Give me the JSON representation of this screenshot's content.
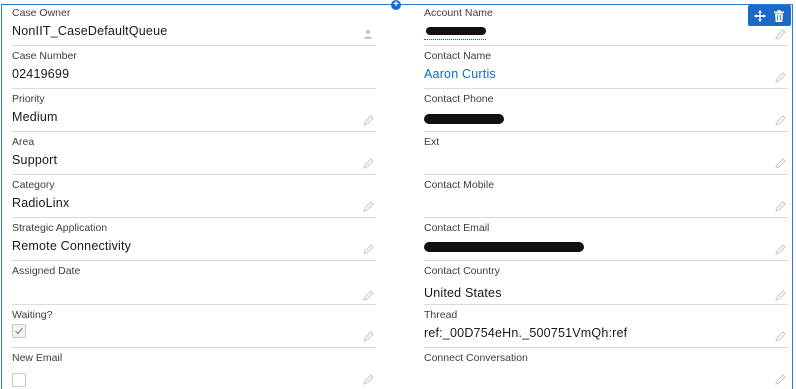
{
  "left_fields": [
    {
      "label": "Case Owner",
      "value": "NonIIT_CaseDefaultQueue",
      "type": "text",
      "icon": "user-change-icon"
    },
    {
      "label": "Case Number",
      "value": "02419699",
      "type": "text"
    },
    {
      "label": "Priority",
      "value": "Medium",
      "type": "text",
      "icon": "pencil-icon"
    },
    {
      "label": "Area",
      "value": "Support",
      "type": "text",
      "icon": "pencil-icon"
    },
    {
      "label": "Category",
      "value": "RadioLinx",
      "type": "text",
      "icon": "pencil-icon"
    },
    {
      "label": "Strategic Application",
      "value": "Remote Connectivity",
      "type": "text",
      "icon": "pencil-icon"
    },
    {
      "label": "Assigned Date",
      "value": "",
      "type": "text",
      "icon": "pencil-icon"
    },
    {
      "label": "Waiting?",
      "checked": true,
      "type": "checkbox",
      "icon": "pencil-icon"
    },
    {
      "label": "New Email",
      "checked": false,
      "type": "checkbox",
      "icon": "pencil-icon"
    }
  ],
  "right_fields": [
    {
      "label": "Account Name",
      "value": "",
      "type": "redacted",
      "icon": "pencil-icon"
    },
    {
      "label": "Contact Name",
      "value": "Aaron Curtis",
      "type": "link",
      "icon": "pencil-icon"
    },
    {
      "label": "Contact Phone",
      "value": "",
      "type": "redacted",
      "icon": "pencil-icon"
    },
    {
      "label": "Ext",
      "value": "",
      "type": "text",
      "icon": "pencil-icon"
    },
    {
      "label": "Contact Mobile",
      "value": "",
      "type": "text",
      "icon": "pencil-icon"
    },
    {
      "label": "Contact Email",
      "value": "",
      "type": "redacted",
      "icon": "pencil-icon"
    },
    {
      "label": "Contact Country",
      "value": "United States",
      "type": "text",
      "icon": "pencil-icon"
    },
    {
      "label": "Thread",
      "value": "ref:_00D754eHn._500751VmQh:ref",
      "type": "text",
      "icon": "pencil-icon"
    },
    {
      "label": "Connect Conversation",
      "value": "",
      "type": "text",
      "icon": "pencil-icon"
    }
  ],
  "toolbar": {
    "move_icon": "move-icon",
    "delete_icon": "trash-icon",
    "add_icon": "plus-icon"
  },
  "colors": {
    "accent": "#1b6ac9",
    "link": "#0b6ec5",
    "border": "#dddbda"
  }
}
